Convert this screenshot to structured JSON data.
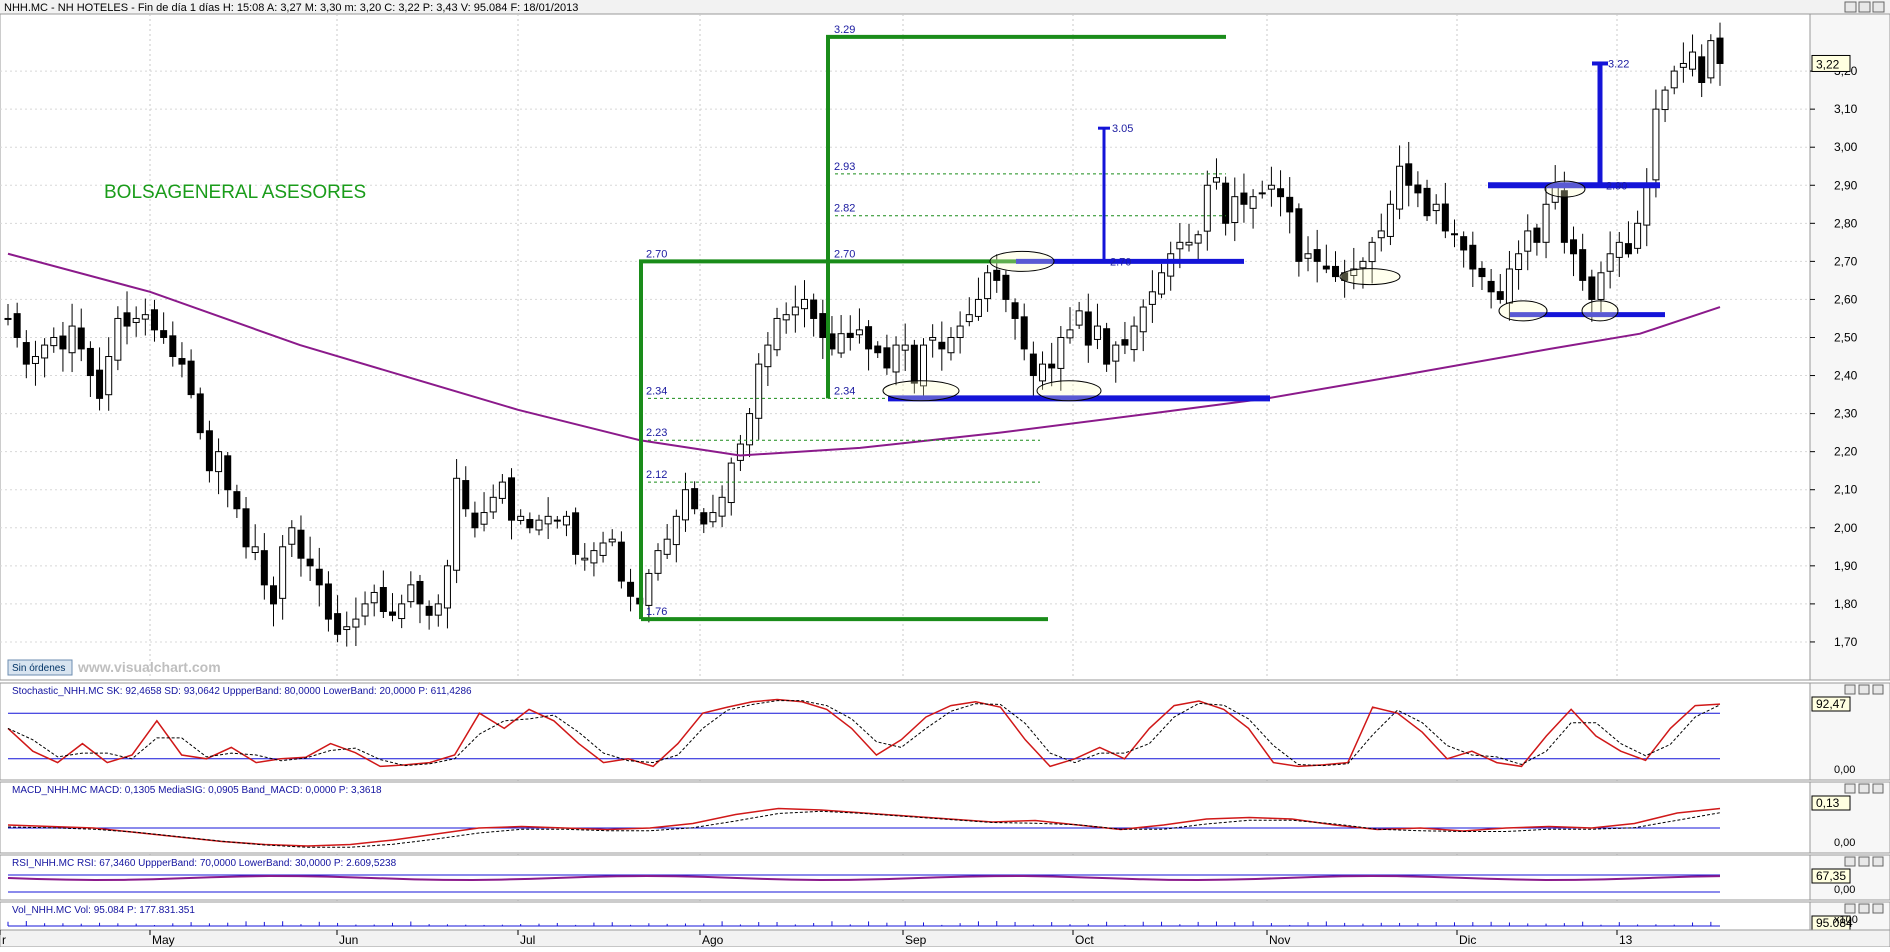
{
  "chart_data": [
    {
      "type": "candlestick",
      "header": "NHH.MC - NH HOTELES - Fin de día 1 días  H: 15:08  A: 3,27  M: 3,30  m: 3,20  C: 3,22  P: 3,43  V: 95.084  F: 18/01/2013",
      "watermark": "BOLSAGENERAL ASESORES",
      "site": "www.visualchart.com",
      "order_button": "Sin órdenes",
      "last_value": "3,22",
      "ylim": [
        1.6,
        3.35
      ],
      "ytick_labels": [
        "1,70",
        "1,80",
        "1,90",
        "2,00",
        "2,10",
        "2,20",
        "2,30",
        "2,40",
        "2,50",
        "2,60",
        "2,70",
        "2,80",
        "2,90",
        "3,00",
        "3,10",
        "3,20"
      ],
      "xtick_labels": [
        "r",
        "May",
        "Jun",
        "Jul",
        "Ago",
        "Sep",
        "Oct",
        "Nov",
        "Dic",
        "13"
      ],
      "candles_close": [
        2.55,
        2.5,
        2.43,
        2.45,
        2.48,
        2.5,
        2.47,
        2.53,
        2.47,
        2.4,
        2.34,
        2.45,
        2.55,
        2.53,
        2.55,
        2.56,
        2.52,
        2.5,
        2.45,
        2.43,
        2.35,
        2.25,
        2.15,
        2.2,
        2.1,
        2.05,
        1.95,
        1.95,
        1.85,
        1.8,
        1.95,
        2.0,
        1.92,
        1.9,
        1.85,
        1.76,
        1.72,
        1.74,
        1.76,
        1.8,
        1.83,
        1.78,
        1.77,
        1.8,
        1.85,
        1.8,
        1.77,
        1.8,
        1.9,
        2.13,
        2.05,
        2.0,
        2.04,
        2.08,
        2.12,
        2.02,
        2.03,
        2.0,
        2.02,
        2.03,
        2.02,
        2.03,
        1.93,
        1.92,
        1.94,
        1.96,
        1.97,
        1.86,
        1.82,
        1.8,
        1.88,
        1.94,
        1.97,
        2.03,
        2.1,
        2.05,
        2.01,
        2.04,
        2.08,
        2.17,
        2.22,
        2.3,
        2.43,
        2.48,
        2.55,
        2.56,
        2.58,
        2.6,
        2.55,
        2.5,
        2.47,
        2.51,
        2.5,
        2.52,
        2.47,
        2.46,
        2.42,
        2.48,
        2.48,
        2.38,
        2.48,
        2.5,
        2.47,
        2.5,
        2.53,
        2.56,
        2.6,
        2.67,
        2.65,
        2.6,
        2.55,
        2.47,
        2.4,
        2.43,
        2.42,
        2.5,
        2.52,
        2.57,
        2.48,
        2.53,
        2.43,
        2.48,
        2.48,
        2.53,
        2.58,
        2.62,
        2.67,
        2.72,
        2.75,
        2.75,
        2.77,
        2.9,
        2.92,
        2.8,
        2.87,
        2.85,
        2.87,
        2.88,
        2.9,
        2.87,
        2.83,
        2.7,
        2.72,
        2.7,
        2.68,
        2.66,
        2.65,
        2.68,
        2.7,
        2.75,
        2.78,
        2.85,
        2.95,
        2.9,
        2.88,
        2.82,
        2.85,
        2.78,
        2.77,
        2.73,
        2.68,
        2.66,
        2.62,
        2.6,
        2.68,
        2.72,
        2.78,
        2.75,
        2.85,
        2.9,
        2.75,
        2.72,
        2.65,
        2.6,
        2.67,
        2.72,
        2.75,
        2.72,
        2.8,
        2.9,
        3.1,
        3.15,
        3.2,
        3.22,
        3.25,
        3.17,
        3.28,
        3.22
      ],
      "stochastic": {
        "label": "Stochastic_NHH.MC  SK: 92,4658  SD: 93,0642  UppperBand: 80,0000  LowerBand: 20,0000  P: 611,4286",
        "value": "92,47",
        "axis_zero": "0,00",
        "upper": 80,
        "lower": 20
      },
      "macd": {
        "label": "MACD_NHH.MC  MACD: 0,1305  MediaSIG: 0,0905  Band_MACD: 0,0000  P: 3,3618",
        "value": "0,13",
        "axis_zero": "0,00"
      },
      "rsi": {
        "label": "RSI_NHH.MC  RSI: 67,3460  UppperBand: 70,0000  LowerBand: 30,0000  P: 2.609,5238",
        "value": "67,35",
        "axis_zero": "0,00"
      },
      "volume": {
        "label": "Vol_NHH.MC  Vol: 95.084  P: 177.831.351",
        "value": "95.084",
        "axis_zero": "x100"
      },
      "annotations": {
        "fib_left": [
          "2.70",
          "2.34",
          "2.23",
          "2.12",
          "1.76"
        ],
        "fib_right": [
          "3.29",
          "2.93",
          "2.82",
          "2.70",
          "2.34"
        ],
        "targets": [
          "3.05",
          "2.70",
          "3.22",
          "2.90"
        ]
      }
    }
  ]
}
